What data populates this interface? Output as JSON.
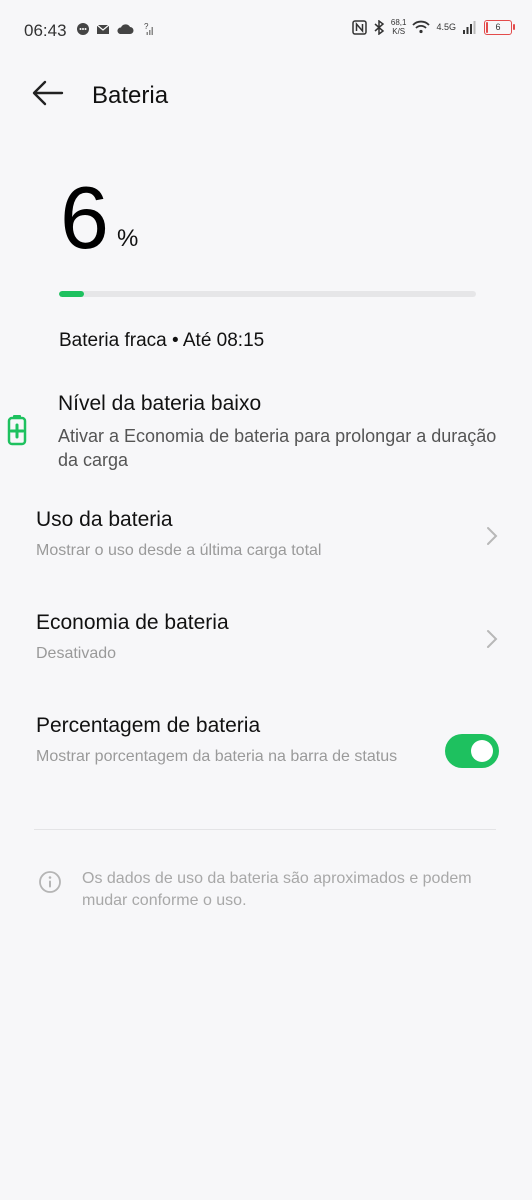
{
  "status_bar": {
    "time": "06:43",
    "net_speed_value": "68,1",
    "net_speed_unit": "K/S",
    "network": "4.5G",
    "battery_level": "6",
    "battery_fraction": 0.06
  },
  "header": {
    "title": "Bateria"
  },
  "battery": {
    "percent": "6",
    "percent_sign": "%",
    "level_fraction": 0.06,
    "status_text": "Bateria fraca • Até 08:15",
    "accent_color": "#1ec15f"
  },
  "low_battery": {
    "title": "Nível da bateria baixo",
    "description": "Ativar a Economia de bateria para prolongar a duração da carga",
    "icon": "battery-charge-icon"
  },
  "settings": [
    {
      "title": "Uso da bateria",
      "subtitle": "Mostrar o uso desde a última carga total"
    },
    {
      "title": "Economia de bateria",
      "subtitle": "Desativado"
    },
    {
      "title": "Percentagem de bateria",
      "subtitle": "Mostrar porcentagem da bateria na barra de status",
      "toggle_on": true
    }
  ],
  "info": {
    "text": "Os dados de uso da bateria são aproximados e podem mudar conforme o uso.",
    "icon": "info-icon"
  }
}
